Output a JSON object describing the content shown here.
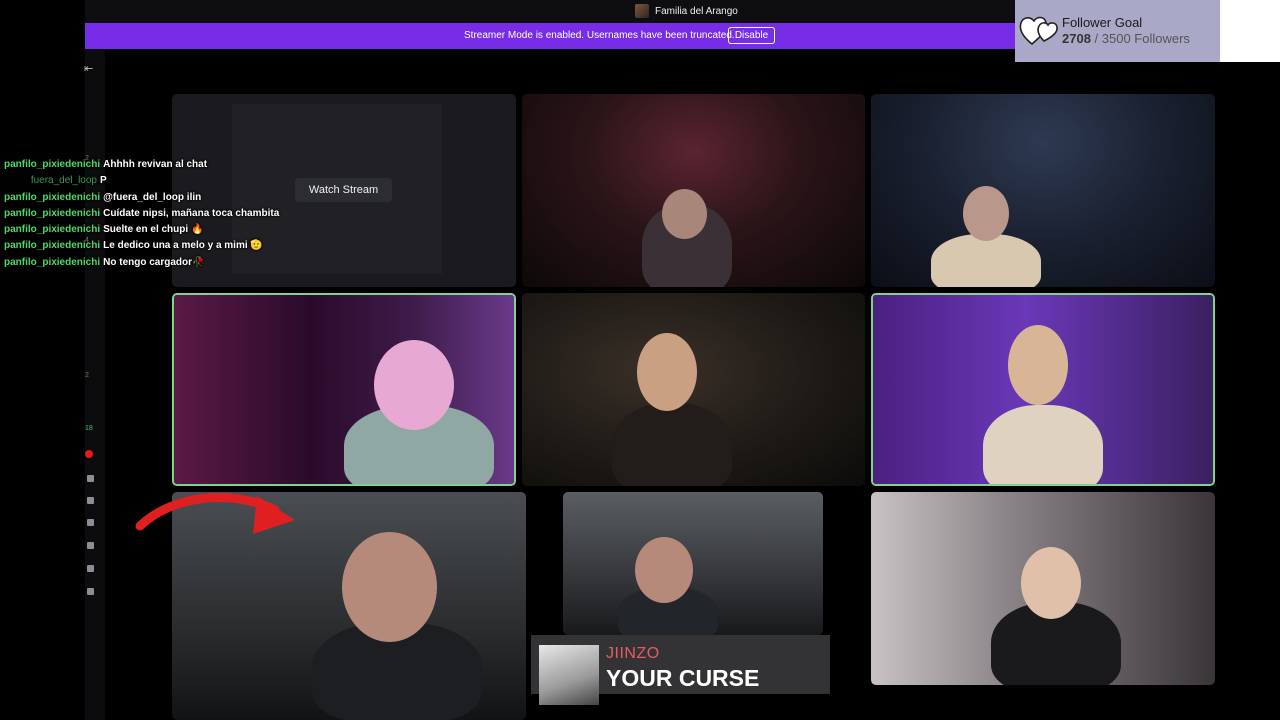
{
  "topbar": {
    "channel_title": "Familia del Arango"
  },
  "streamer_mode_banner": {
    "text": "Streamer Mode is enabled. Usernames have been truncated.",
    "button_label": "Disable"
  },
  "follower_goal": {
    "title": "Follower Goal",
    "current": "2708",
    "separator": " / ",
    "target": "3500 Followers",
    "progress_fraction": 0.774
  },
  "left_rail": {
    "numbers": [
      "2",
      "4",
      "2"
    ],
    "live_badge_count": "18"
  },
  "watch_tile": {
    "button_label": "Watch Stream"
  },
  "chat": {
    "messages": [
      {
        "user": "panfilo_pixiedenichi",
        "text": "Ahhhh revivan al chat",
        "alt": false
      },
      {
        "user": "fuera_del_loop",
        "text": "P",
        "alt": true
      },
      {
        "user": "panfilo_pixiedenichi",
        "text": "@fuera_del_loop ilin",
        "alt": false
      },
      {
        "user": "panfilo_pixiedenichi",
        "text": "Cuídate nipsi, mañana toca chambita",
        "alt": false
      },
      {
        "user": "panfilo_pixiedenichi",
        "text": "Suelte en el chupi 🔥",
        "alt": false
      },
      {
        "user": "panfilo_pixiedenichi",
        "text": "Le dedico una a melo y a mimi 🫡",
        "alt": false
      },
      {
        "user": "panfilo_pixiedenichi",
        "text": "No tengo cargador🥀",
        "alt": false
      }
    ]
  },
  "now_playing": {
    "artist": "JIINZO",
    "song": "YOUR CURSE"
  },
  "colors": {
    "brand_purple": "#772ce8",
    "chat_user_green": "#4cd964",
    "highlight_border": "#7fd38a",
    "live_red": "#e91916"
  }
}
